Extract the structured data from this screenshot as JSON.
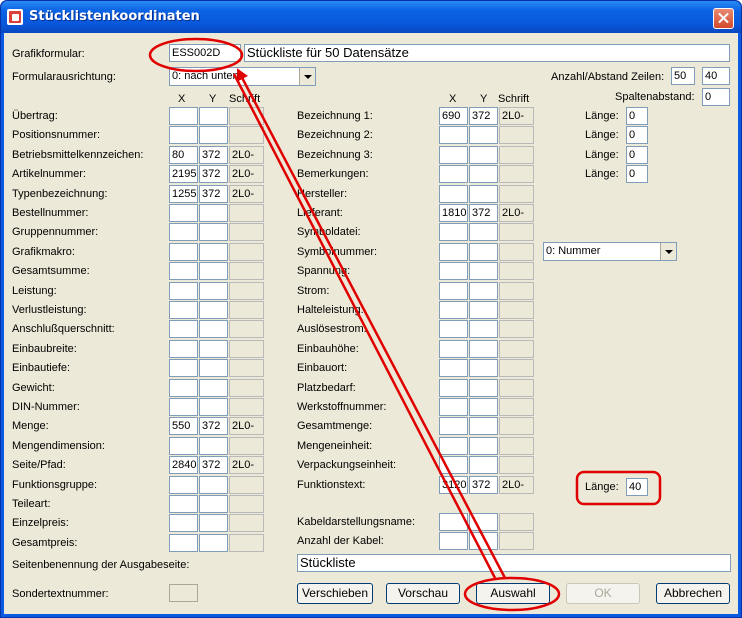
{
  "window": {
    "title": "Stücklistenkoordinaten"
  },
  "header": {
    "grafikformular_label": "Grafikformular:",
    "grafikformular_value": "ESS002D",
    "grafikformular_desc": "Stückliste für 50 Datensätze",
    "ausrichtung_label": "Formularausrichtung:",
    "ausrichtung_value": "0: nach unten",
    "anzahl_label": "Anzahl/Abstand Zeilen:",
    "anzahl_value": "50",
    "abstand_value": "40",
    "spaltenabstand_label": "Spaltenabstand:",
    "spaltenabstand_value": "0"
  },
  "columns": {
    "x": "X",
    "y": "Y",
    "schrift": "Schrift"
  },
  "left_fields": [
    {
      "label": "Übertrag:",
      "x": "",
      "y": "",
      "s": ""
    },
    {
      "label": "Positionsnummer:",
      "x": "",
      "y": "",
      "s": ""
    },
    {
      "label": "Betriebsmittelkennzeichen:",
      "x": "80",
      "y": "372",
      "s": "2L0-"
    },
    {
      "label": "Artikelnummer:",
      "x": "2195",
      "y": "372",
      "s": "2L0-"
    },
    {
      "label": "Typenbezeichnung:",
      "x": "1255",
      "y": "372",
      "s": "2L0-"
    },
    {
      "label": "Bestellnummer:",
      "x": "",
      "y": "",
      "s": ""
    },
    {
      "label": "Gruppennummer:",
      "x": "",
      "y": "",
      "s": ""
    },
    {
      "label": "Grafikmakro:",
      "x": "",
      "y": "",
      "s": ""
    },
    {
      "label": "Gesamtsumme:",
      "x": "",
      "y": "",
      "s": ""
    },
    {
      "label": "Leistung:",
      "x": "",
      "y": "",
      "s": ""
    },
    {
      "label": "Verlustleistung:",
      "x": "",
      "y": "",
      "s": ""
    },
    {
      "label": "Anschlußquerschnitt:",
      "x": "",
      "y": "",
      "s": ""
    },
    {
      "label": "Einbaubreite:",
      "x": "",
      "y": "",
      "s": ""
    },
    {
      "label": "Einbautiefe:",
      "x": "",
      "y": "",
      "s": ""
    },
    {
      "label": "Gewicht:",
      "x": "",
      "y": "",
      "s": ""
    },
    {
      "label": "DIN-Nummer:",
      "x": "",
      "y": "",
      "s": ""
    },
    {
      "label": "Menge:",
      "x": "550",
      "y": "372",
      "s": "2L0-"
    },
    {
      "label": "Mengendimension:",
      "x": "",
      "y": "",
      "s": ""
    },
    {
      "label": "Seite/Pfad:",
      "x": "2840",
      "y": "372",
      "s": "2L0-"
    },
    {
      "label": "Funktionsgruppe:",
      "x": "",
      "y": "",
      "s": ""
    },
    {
      "label": "Teileart:",
      "x": "",
      "y": "",
      "s": ""
    },
    {
      "label": "Einzelpreis:",
      "x": "",
      "y": "",
      "s": ""
    },
    {
      "label": "Gesamtpreis:",
      "x": "",
      "y": "",
      "s": ""
    }
  ],
  "right_fields": [
    {
      "label": "Bezeichnung 1:",
      "x": "690",
      "y": "372",
      "s": "2L0-"
    },
    {
      "label": "Bezeichnung 2:",
      "x": "",
      "y": "",
      "s": ""
    },
    {
      "label": "Bezeichnung 3:",
      "x": "",
      "y": "",
      "s": ""
    },
    {
      "label": "Bemerkungen:",
      "x": "",
      "y": "",
      "s": ""
    },
    {
      "label": "Hersteller:",
      "x": "",
      "y": "",
      "s": ""
    },
    {
      "label": "Lieferant:",
      "x": "1810",
      "y": "372",
      "s": "2L0-"
    },
    {
      "label": "Symboldatei:",
      "x": "",
      "y": "",
      "s": ""
    },
    {
      "label": "Symbolnummer:",
      "x": "",
      "y": "",
      "s": ""
    },
    {
      "label": "Spannung:",
      "x": "",
      "y": "",
      "s": ""
    },
    {
      "label": "Strom:",
      "x": "",
      "y": "",
      "s": ""
    },
    {
      "label": "Halteleistung:",
      "x": "",
      "y": "",
      "s": ""
    },
    {
      "label": "Auslösestrom:",
      "x": "",
      "y": "",
      "s": ""
    },
    {
      "label": "Einbauhöhe:",
      "x": "",
      "y": "",
      "s": ""
    },
    {
      "label": "Einbauort:",
      "x": "",
      "y": "",
      "s": ""
    },
    {
      "label": "Platzbedarf:",
      "x": "",
      "y": "",
      "s": ""
    },
    {
      "label": "Werkstoffnummer:",
      "x": "",
      "y": "",
      "s": ""
    },
    {
      "label": "Gesamtmenge:",
      "x": "",
      "y": "",
      "s": ""
    },
    {
      "label": "Mengeneinheit:",
      "x": "",
      "y": "",
      "s": ""
    },
    {
      "label": "Verpackungseinheit:",
      "x": "",
      "y": "",
      "s": ""
    },
    {
      "label": "Funktionstext:",
      "x": "3120",
      "y": "372",
      "s": "2L0-"
    }
  ],
  "kabel_fields": [
    {
      "label": "Kabeldarstellungsname:",
      "x": "",
      "y": "",
      "s": ""
    },
    {
      "label": "Anzahl der Kabel:",
      "x": "",
      "y": "",
      "s": ""
    }
  ],
  "laenge": [
    {
      "label": "Länge:",
      "value": "0"
    },
    {
      "label": "Länge:",
      "value": "0"
    },
    {
      "label": "Länge:",
      "value": "0"
    },
    {
      "label": "Länge:",
      "value": "0"
    },
    {
      "label": "Länge:",
      "value": "40"
    }
  ],
  "symbol_select": {
    "value": "0: Nummer"
  },
  "seitenbenennung": {
    "label": "Seitenbenennung der Ausgabeseite:",
    "value": "Stückliste"
  },
  "sondertext": {
    "label": "Sondertextnummer:",
    "value": ""
  },
  "buttons": {
    "verschieben": "Verschieben",
    "vorschau": "Vorschau",
    "auswahl": "Auswahl",
    "ok": "OK",
    "abbrechen": "Abbrechen"
  },
  "annotation_color": "#e00000"
}
